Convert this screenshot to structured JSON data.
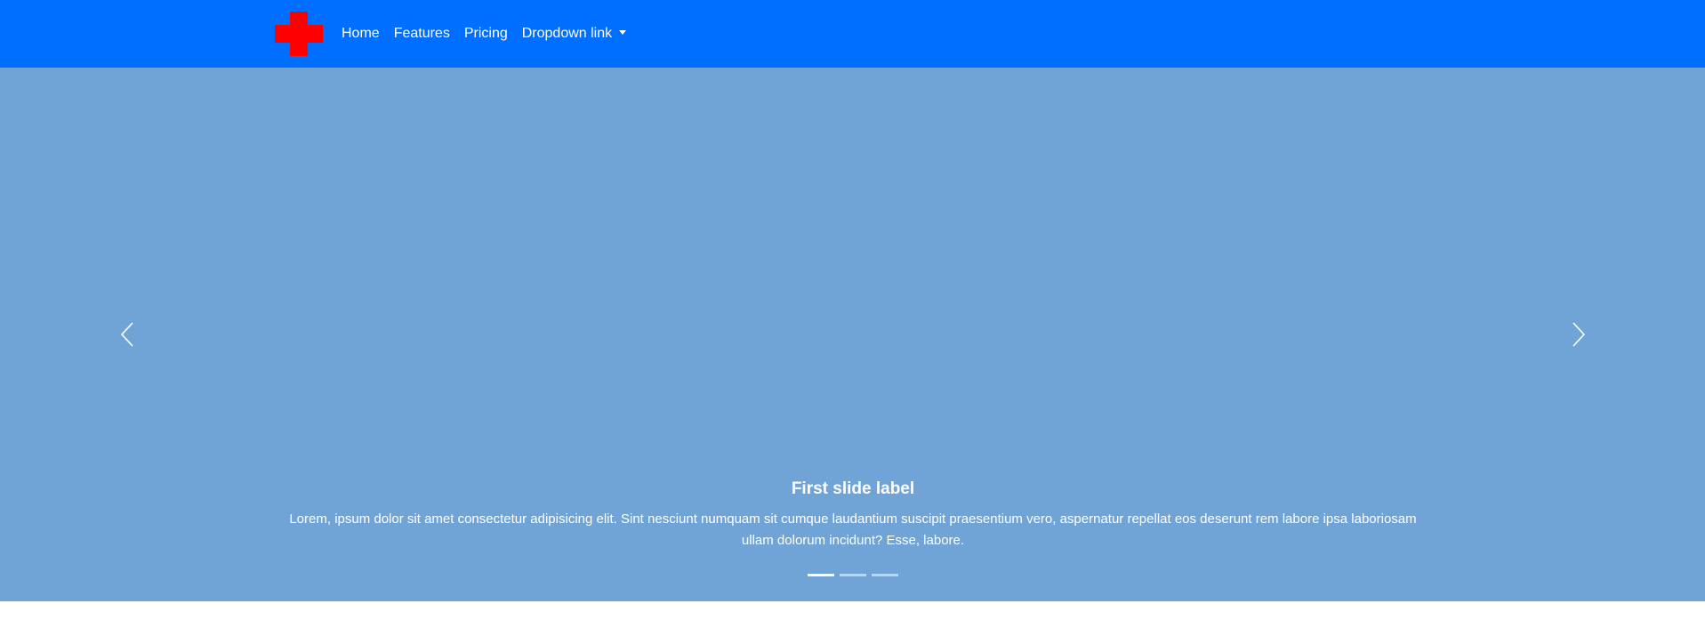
{
  "navbar": {
    "background_color": "#006eff",
    "logo_icon": "red-cross-icon",
    "logo_color": "#ff0000",
    "links": [
      {
        "label": "Home"
      },
      {
        "label": "Features"
      },
      {
        "label": "Pricing"
      },
      {
        "label": "Dropdown link",
        "has_dropdown": true
      }
    ]
  },
  "carousel": {
    "background_color": "#70a4d6",
    "prev_icon": "chevron-left-icon",
    "next_icon": "chevron-right-icon",
    "caption": {
      "title": "First slide label",
      "text": "Lorem, ipsum dolor sit amet consectetur adipisicing elit. Sint nesciunt numquam sit cumque laudantium suscipit praesentium vero, aspernatur repellat eos deserunt rem labore ipsa laboriosam ullam dolorum incidunt? Esse, labore."
    },
    "indicators": [
      {
        "active": true
      },
      {
        "active": false
      },
      {
        "active": false
      }
    ]
  }
}
